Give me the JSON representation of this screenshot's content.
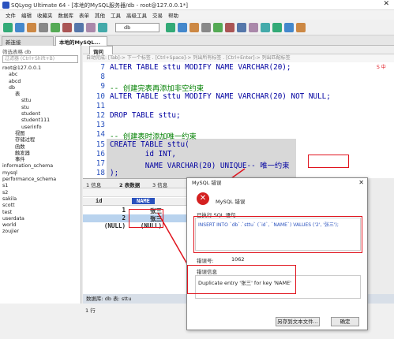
{
  "window": {
    "title": "SQLyog Ultimate 64 - [本地的MySQL服务器/db - root@127.0.0.1*]"
  },
  "menu": [
    "文件",
    "编辑",
    "收藏夹",
    "数据库",
    "表单",
    "其他",
    "工具",
    "高级工具",
    "交易",
    "帮助"
  ],
  "toolbar": {
    "db_select": "db"
  },
  "tabs": [
    {
      "label": "新连接"
    },
    {
      "label": "本地的MySQL..."
    }
  ],
  "left": {
    "filter_label": "筛选表格  db",
    "filter_placeholder": "过滤器 (Ctrl+Shift+B)",
    "tree": [
      "root@127.0.0.1",
      "abc",
      "abcd",
      "db",
      "表",
      "sttu",
      "stu",
      "student",
      "student111",
      "userinfo",
      "视图",
      "存储过程",
      "函数",
      "触发器",
      "事件",
      "information_schema",
      "mysql",
      "performance_schema",
      "s1",
      "s2",
      "sakila",
      "scott",
      "test",
      "userdata",
      "world",
      "zoujier"
    ]
  },
  "editor": {
    "tab_label": "询问",
    "hint": "自动完成: [Tab]-> 下一个标签 . [Ctrl+Space]-> 列出所有标签 . [Ctrl+Enter]-> 列出匹配标签",
    "lines": [
      {
        "n": "7",
        "text": "ALTER TABLE sttu MODIFY NAME VARCHAR(20);",
        "cls": ""
      },
      {
        "n": "8",
        "text": "",
        "cls": ""
      },
      {
        "n": "9",
        "text": "-- 创建完表再添加非空约束",
        "cls": "cmt"
      },
      {
        "n": "10",
        "text": "ALTER TABLE sttu MODIFY NAME VARCHAR(20) NOT NULL;",
        "cls": ""
      },
      {
        "n": "11",
        "text": "",
        "cls": ""
      },
      {
        "n": "12",
        "text": "DROP TABLE sttu;",
        "cls": ""
      },
      {
        "n": "13",
        "text": "",
        "cls": ""
      },
      {
        "n": "14",
        "text": "-- 创建表时添加唯一约束",
        "cls": "cmt"
      },
      {
        "n": "15",
        "text": "CREATE TABLE sttu(",
        "cls": ""
      },
      {
        "n": "16",
        "text": "        id INT,",
        "cls": ""
      },
      {
        "n": "17",
        "text": "        NAME VARCHAR(20) UNIQUE-- 唯一约束",
        "cls": ""
      },
      {
        "n": "18",
        "text": ");",
        "cls": ""
      }
    ]
  },
  "results": {
    "tabs": [
      "1 信息",
      "2 表数据",
      "3 信息"
    ],
    "columns": [
      "id",
      "NAME"
    ],
    "rows": [
      [
        "1",
        "张三"
      ],
      [
        "2",
        "张三"
      ],
      [
        "(NULL)",
        "(NULL)"
      ]
    ]
  },
  "status": {
    "db_label": "数据库: db  表: sttu",
    "rows": "1 行"
  },
  "dialog": {
    "title": "MySQL 错误",
    "header": "MySQL 错误",
    "exec_label": "已执行 SQL 语句",
    "sql": "INSERT INTO `db`.`sttu` (`id`, `NAME`) VALUES ('2', '张三');",
    "code_label": "错误号:",
    "code": "1062",
    "msg_label": "错误信息",
    "message": "Duplicate entry '张三' for key 'NAME'",
    "save_btn": "另存到文本文件...",
    "ok_btn": "确定"
  },
  "colors": {
    "accent": "#2a52be",
    "error": "#e0141e",
    "selection": "#b9d3ee",
    "comment": "#008000"
  }
}
